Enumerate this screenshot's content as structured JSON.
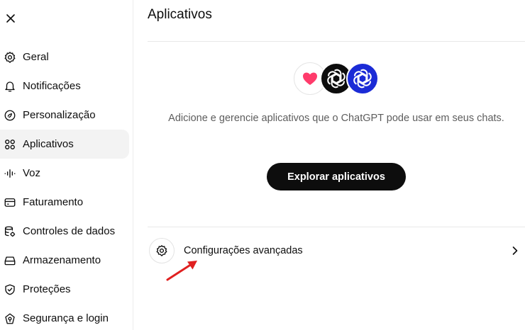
{
  "sidebar": {
    "close_label": "Fechar",
    "items": [
      {
        "label": "Geral",
        "icon": "gear-icon"
      },
      {
        "label": "Notificações",
        "icon": "bell-icon"
      },
      {
        "label": "Personalização",
        "icon": "personalization-icon"
      },
      {
        "label": "Aplicativos",
        "icon": "apps-grid-icon",
        "active": true
      },
      {
        "label": "Voz",
        "icon": "voice-wave-icon"
      },
      {
        "label": "Faturamento",
        "icon": "credit-card-icon"
      },
      {
        "label": "Controles de dados",
        "icon": "data-controls-icon"
      },
      {
        "label": "Armazenamento",
        "icon": "storage-icon"
      },
      {
        "label": "Proteções",
        "icon": "shield-icon"
      },
      {
        "label": "Segurança e login",
        "icon": "security-icon"
      }
    ]
  },
  "main": {
    "title": "Aplicativos",
    "app_icons": [
      "health-heart-icon",
      "openai-logo-icon",
      "openai-logo-blue-icon"
    ],
    "description": "Adicione e gerencie aplicativos que o ChatGPT pode usar em seus chats.",
    "explore_button": "Explorar aplicativos",
    "advanced_settings": "Configurações avançadas"
  },
  "colors": {
    "text": "#0d0d0d",
    "muted_text": "#5d5d5d",
    "active_bg": "#f3f3f3",
    "button_bg": "#0d0d0d",
    "blue_app": "#1b2bd6",
    "heart": "#ff3b6b",
    "annotation_arrow": "#e02020"
  }
}
